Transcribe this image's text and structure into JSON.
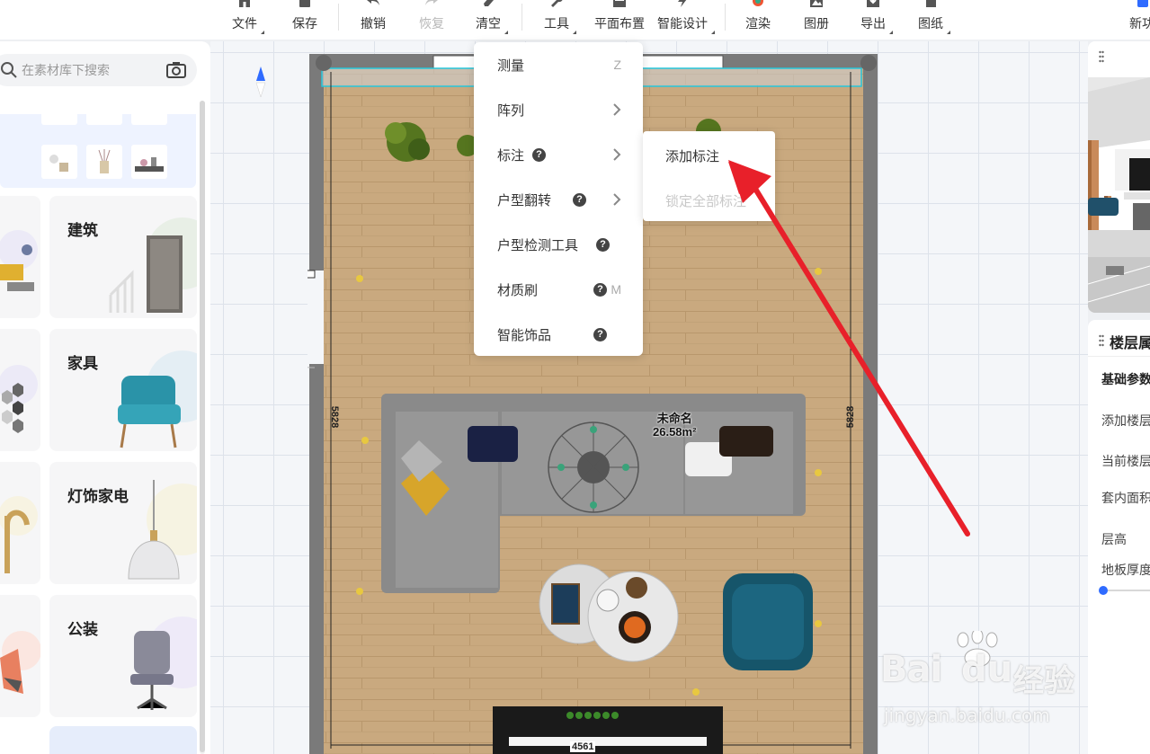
{
  "toolbar": {
    "file": "文件",
    "save": "保存",
    "undo": "撤销",
    "redo": "恢复",
    "clear": "清空",
    "tools": "工具",
    "layout": "平面布置",
    "smart_design": "智能设计",
    "render": "渲染",
    "album": "图册",
    "export": "导出",
    "drawing": "图纸",
    "new_feature": "新功"
  },
  "sidebar": {
    "search_placeholder": "在素材库下搜索",
    "categories": [
      {
        "label": "建筑"
      },
      {
        "label": "家具"
      },
      {
        "label": "灯饰家电"
      },
      {
        "label": "公装"
      }
    ]
  },
  "floorplan": {
    "room_name": "未命名",
    "room_area": "26.58m²",
    "dim_left": "5828",
    "dim_right": "5828",
    "dim_bottom": "4561"
  },
  "tools_menu": {
    "items": [
      {
        "label": "测量",
        "shortcut": "Z"
      },
      {
        "label": "阵列"
      },
      {
        "label": "标注"
      },
      {
        "label": "户型翻转"
      },
      {
        "label": "户型检测工具"
      },
      {
        "label": "材质刷",
        "shortcut": "M"
      },
      {
        "label": "智能饰品"
      }
    ],
    "help_glyph": "?"
  },
  "annotation_submenu": {
    "add": "添加标注",
    "lock_all": "锁定全部标注"
  },
  "floor_panel": {
    "title": "楼层属",
    "basic_params": "基础参数",
    "add_floor": "添加楼层",
    "current_floor": "当前楼层",
    "inner_area": "套内面积",
    "floor_height": "层高",
    "floor_thickness": "地板厚度"
  },
  "watermark": {
    "brand": "Bai",
    "brand2": "du",
    "jingyan": "经验",
    "url": "jingyan.baidu.com"
  },
  "colors": {
    "accent_blue": "#2f6bff",
    "arrow_red": "#e8202a",
    "wall_gray": "#7a7a7a",
    "floor_wood": "#c9a97f"
  }
}
